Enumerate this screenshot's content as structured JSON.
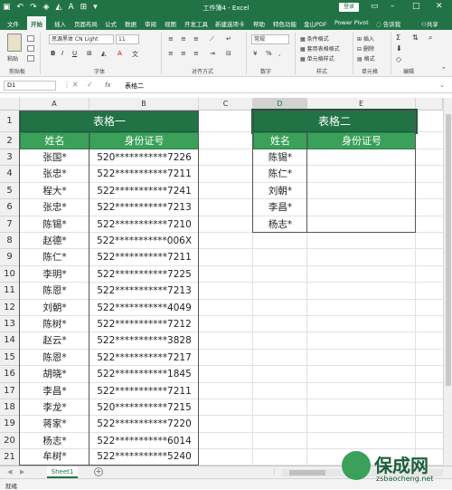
{
  "window": {
    "title": "工作簿4 - Excel",
    "login_label": "登录"
  },
  "tabs": [
    "文件",
    "开始",
    "插入",
    "页面布局",
    "公式",
    "数据",
    "审阅",
    "视图",
    "开发工具",
    "新建选项卡",
    "帮助",
    "特色功能",
    "金山PDF",
    "Power Pivot",
    "告诉我",
    "共享"
  ],
  "ribbon": {
    "font_name": "思源黑体 CN Light",
    "font_size": "11",
    "number_format": "常规",
    "groups": {
      "clipboard": "剪贴板",
      "font": "字体",
      "alignment": "对齐方式",
      "number": "数字",
      "styles": "样式",
      "cells": "单元格",
      "editing": "编辑"
    },
    "paste_label": "粘贴",
    "styles_items": [
      "条件格式",
      "套用表格格式",
      "单元格样式"
    ],
    "cells_items": [
      "插入",
      "删除",
      "格式"
    ]
  },
  "formula_bar": {
    "name_box": "D1",
    "fx": "fx",
    "content": "表格二"
  },
  "columns": [
    "A",
    "B",
    "C",
    "D",
    "E"
  ],
  "rows": [
    "1",
    "2",
    "3",
    "4",
    "5",
    "6",
    "7",
    "8",
    "9",
    "10",
    "11",
    "12",
    "13",
    "14",
    "15",
    "16",
    "17",
    "18",
    "19",
    "20",
    "21"
  ],
  "table1": {
    "title": "表格一",
    "headers": [
      "姓名",
      "身份证号"
    ],
    "rows": [
      [
        "张国*",
        "520***********7226"
      ],
      [
        "张忠*",
        "522***********7211"
      ],
      [
        "程大*",
        "522***********7241"
      ],
      [
        "张忠*",
        "522***********7213"
      ],
      [
        "陈锡*",
        "522***********7210"
      ],
      [
        "赵德*",
        "522***********006X"
      ],
      [
        "陈仁*",
        "522***********7211"
      ],
      [
        "李明*",
        "522***********7225"
      ],
      [
        "陈恩*",
        "522***********7213"
      ],
      [
        "刘朝*",
        "522***********4049"
      ],
      [
        "陈树*",
        "522***********7212"
      ],
      [
        "赵云*",
        "522***********3828"
      ],
      [
        "陈恩*",
        "522***********7217"
      ],
      [
        "胡晓*",
        "522***********1845"
      ],
      [
        "李昌*",
        "522***********7211"
      ],
      [
        "李龙*",
        "520***********7215"
      ],
      [
        "蒋家*",
        "522***********7220"
      ],
      [
        "杨志*",
        "522***********6014"
      ],
      [
        "牟树*",
        "522***********5240"
      ]
    ]
  },
  "table2": {
    "title": "表格二",
    "headers": [
      "姓名",
      "身份证号"
    ],
    "rows": [
      [
        "陈锡*"
      ],
      [
        "陈仁*"
      ],
      [
        "刘朝*"
      ],
      [
        "李昌*"
      ],
      [
        "杨志*"
      ]
    ]
  },
  "sheet_tab": "Sheet1",
  "status": "就绪",
  "watermark": {
    "title": "保成网",
    "url": "zsbaocheng.net"
  },
  "colors": {
    "excel_green": "#217346",
    "header_green": "#3aa05a"
  }
}
